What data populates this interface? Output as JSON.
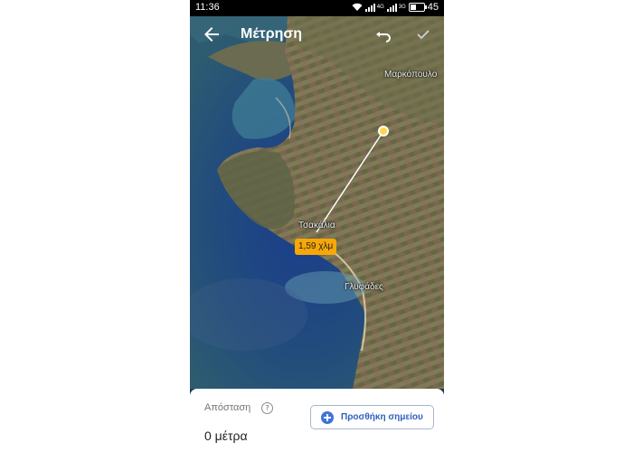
{
  "status_bar": {
    "time": "11:36",
    "network_labels": [
      "4G",
      "3G"
    ],
    "battery": "45",
    "battery_level": 0.45
  },
  "app_bar": {
    "title": "Μέτρηση",
    "back_icon": "arrow-back-icon",
    "undo_icon": "undo-icon",
    "done_icon": "check-icon"
  },
  "map": {
    "places": {
      "top_right": "Μαρκόπουλο",
      "center": "Τσακάλια",
      "south": "Γλυφάδες"
    },
    "measure_label": "1,59 χλμ",
    "colors": {
      "pin": "#ffd54f",
      "line": "#ffffff",
      "label_bg": "#f7a707"
    }
  },
  "bottom_sheet": {
    "distance_label": "Απόσταση",
    "help_icon": "help-circle-icon",
    "distance_value": "0 μέτρα",
    "add_point_label": "Προσθήκη σημείου",
    "accent": "#3f72d6"
  }
}
